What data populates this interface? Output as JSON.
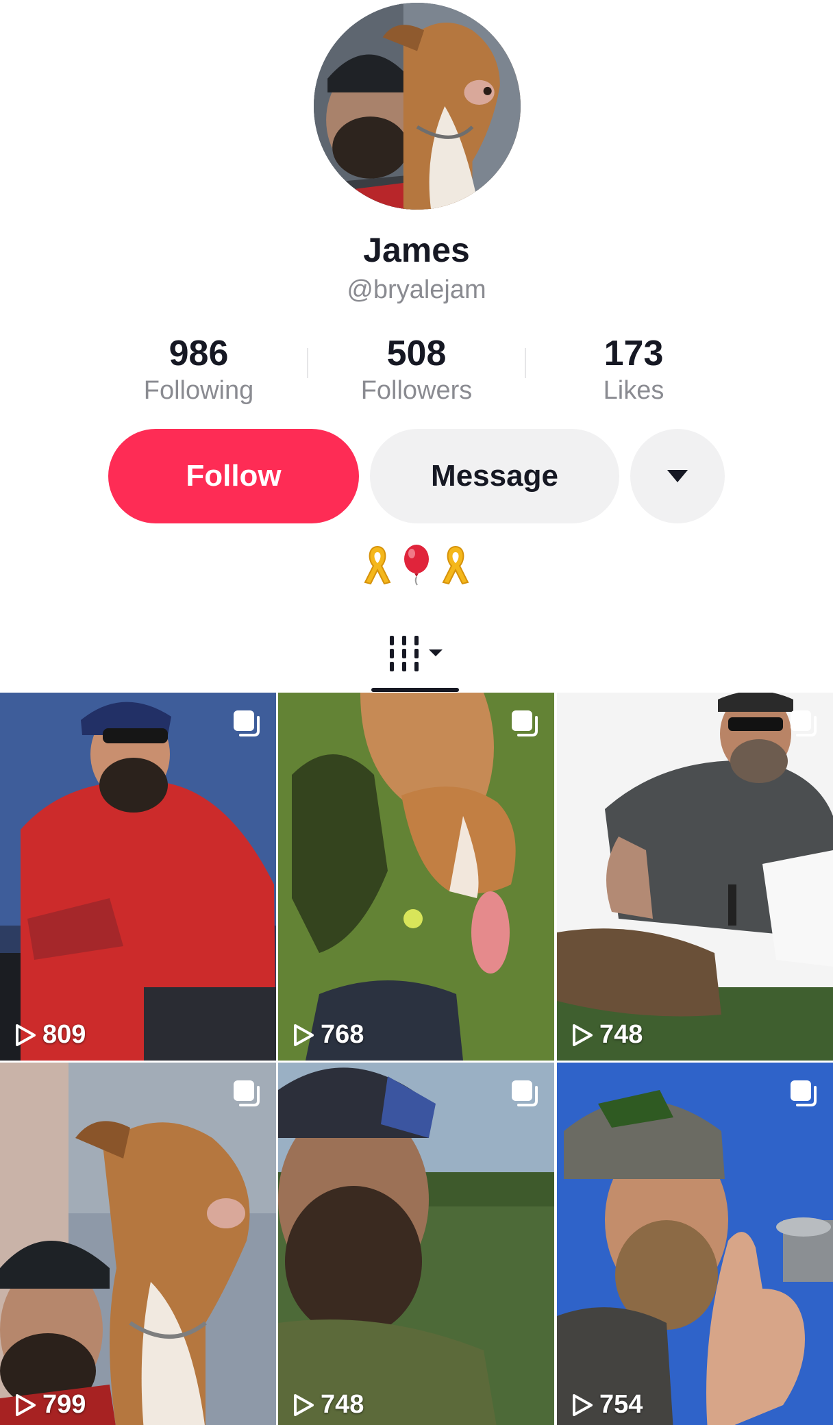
{
  "profile": {
    "display_name": "James",
    "username": "@bryalejam",
    "bio_emoji": [
      "yellow-ribbon",
      "red-balloon",
      "yellow-ribbon"
    ]
  },
  "stats": {
    "following": {
      "value": "986",
      "label": "Following"
    },
    "followers": {
      "value": "508",
      "label": "Followers"
    },
    "likes": {
      "value": "173",
      "label": "Likes"
    }
  },
  "actions": {
    "follow_label": "Follow",
    "message_label": "Message"
  },
  "colors": {
    "accent": "#fe2c55",
    "secondary_button": "#f1f1f2",
    "muted_text": "#8a8b91"
  },
  "videos": [
    {
      "views": "809",
      "multi": true,
      "subject": "man in red hoodie"
    },
    {
      "views": "768",
      "multi": true,
      "subject": "dog on grass"
    },
    {
      "views": "748",
      "multi": true,
      "subject": "man with trimmer"
    },
    {
      "views": "799",
      "multi": true,
      "subject": "man with dog"
    },
    {
      "views": "748",
      "multi": true,
      "subject": "bearded man outdoors"
    },
    {
      "views": "754",
      "multi": true,
      "subject": "man thumbs up"
    }
  ]
}
